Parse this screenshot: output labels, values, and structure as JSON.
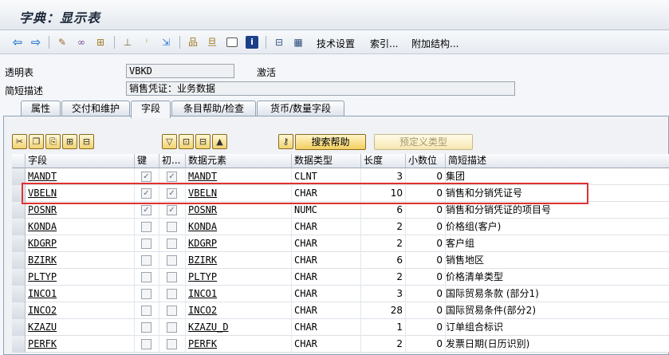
{
  "window": {
    "title": "字典：显示表"
  },
  "toolbar": {
    "items": [
      {
        "name": "back-arrow-icon",
        "glyph": "⇦"
      },
      {
        "name": "forward-arrow-icon",
        "glyph": "⇨"
      },
      {
        "name": "display-change-icon",
        "glyph": "✎"
      },
      {
        "name": "display-glasses-icon",
        "glyph": "∞"
      },
      {
        "name": "object-list-icon",
        "glyph": "⊞"
      },
      {
        "name": "hierarchy-icon",
        "glyph": "⊥"
      },
      {
        "name": "where-used-icon",
        "glyph": "ⁱ"
      },
      {
        "name": "navigate-icon",
        "glyph": "⇲"
      },
      {
        "name": "tree-icon",
        "glyph": "品"
      },
      {
        "name": "hierarchy-down-icon",
        "glyph": "旦"
      },
      {
        "name": "window-icon",
        "glyph": ""
      },
      {
        "name": "info-icon",
        "glyph": "i"
      },
      {
        "name": "layout-icon",
        "glyph": "⊟"
      },
      {
        "name": "table-icon",
        "glyph": "▦"
      }
    ],
    "tech_settings": "技术设置",
    "index": "索引...",
    "append_structure": "附加结构..."
  },
  "header": {
    "transparent_table_label": "透明表",
    "table_name": "VBKD",
    "status": "激活",
    "short_desc_label": "简短描述",
    "short_desc": "销售凭证：业务数据"
  },
  "tabs": [
    {
      "label": "属性"
    },
    {
      "label": "交付和维护"
    },
    {
      "label": "字段"
    },
    {
      "label": "条目帮助/检查"
    },
    {
      "label": "货币/数量字段"
    }
  ],
  "actions": {
    "search_help": "搜索帮助",
    "predefined_type": "预定义类型"
  },
  "columns": {
    "field": "字段",
    "key": "键",
    "init": "初...",
    "data_element": "数据元素",
    "data_type": "数据类型",
    "length": "长度",
    "decimals": "小数位",
    "short_desc": "简短描述"
  },
  "rows": [
    {
      "field": "MANDT",
      "key": "✓",
      "init": "✓",
      "elem": "MANDT",
      "type": "CLNT",
      "len": "3",
      "dec": "0",
      "desc": "集团"
    },
    {
      "field": "VBELN",
      "key": "✓",
      "init": "✓",
      "elem": "VBELN",
      "type": "CHAR",
      "len": "10",
      "dec": "0",
      "desc": "销售和分销凭证号"
    },
    {
      "field": "POSNR",
      "key": "✓",
      "init": "✓",
      "elem": "POSNR",
      "type": "NUMC",
      "len": "6",
      "dec": "0",
      "desc": "销售和分销凭证的项目号"
    },
    {
      "field": "KONDA",
      "key": "",
      "init": "",
      "elem": "KONDA",
      "type": "CHAR",
      "len": "2",
      "dec": "0",
      "desc": "价格组(客户)"
    },
    {
      "field": "KDGRP",
      "key": "",
      "init": "",
      "elem": "KDGRP",
      "type": "CHAR",
      "len": "2",
      "dec": "0",
      "desc": "客户组"
    },
    {
      "field": "BZIRK",
      "key": "",
      "init": "",
      "elem": "BZIRK",
      "type": "CHAR",
      "len": "6",
      "dec": "0",
      "desc": "销售地区"
    },
    {
      "field": "PLTYP",
      "key": "",
      "init": "",
      "elem": "PLTYP",
      "type": "CHAR",
      "len": "2",
      "dec": "0",
      "desc": "价格清单类型"
    },
    {
      "field": "INCO1",
      "key": "",
      "init": "",
      "elem": "INCO1",
      "type": "CHAR",
      "len": "3",
      "dec": "0",
      "desc": "国际贸易条款 (部分1)"
    },
    {
      "field": "INCO2",
      "key": "",
      "init": "",
      "elem": "INCO2",
      "type": "CHAR",
      "len": "28",
      "dec": "0",
      "desc": "国际贸易条件(部分2)"
    },
    {
      "field": "KZAZU",
      "key": "",
      "init": "",
      "elem": "KZAZU_D",
      "type": "CHAR",
      "len": "1",
      "dec": "0",
      "desc": "订单组合标识"
    },
    {
      "field": "PERFK",
      "key": "",
      "init": "",
      "elem": "PERFK",
      "type": "CHAR",
      "len": "2",
      "dec": "0",
      "desc": "发票日期(日历识别)"
    }
  ]
}
